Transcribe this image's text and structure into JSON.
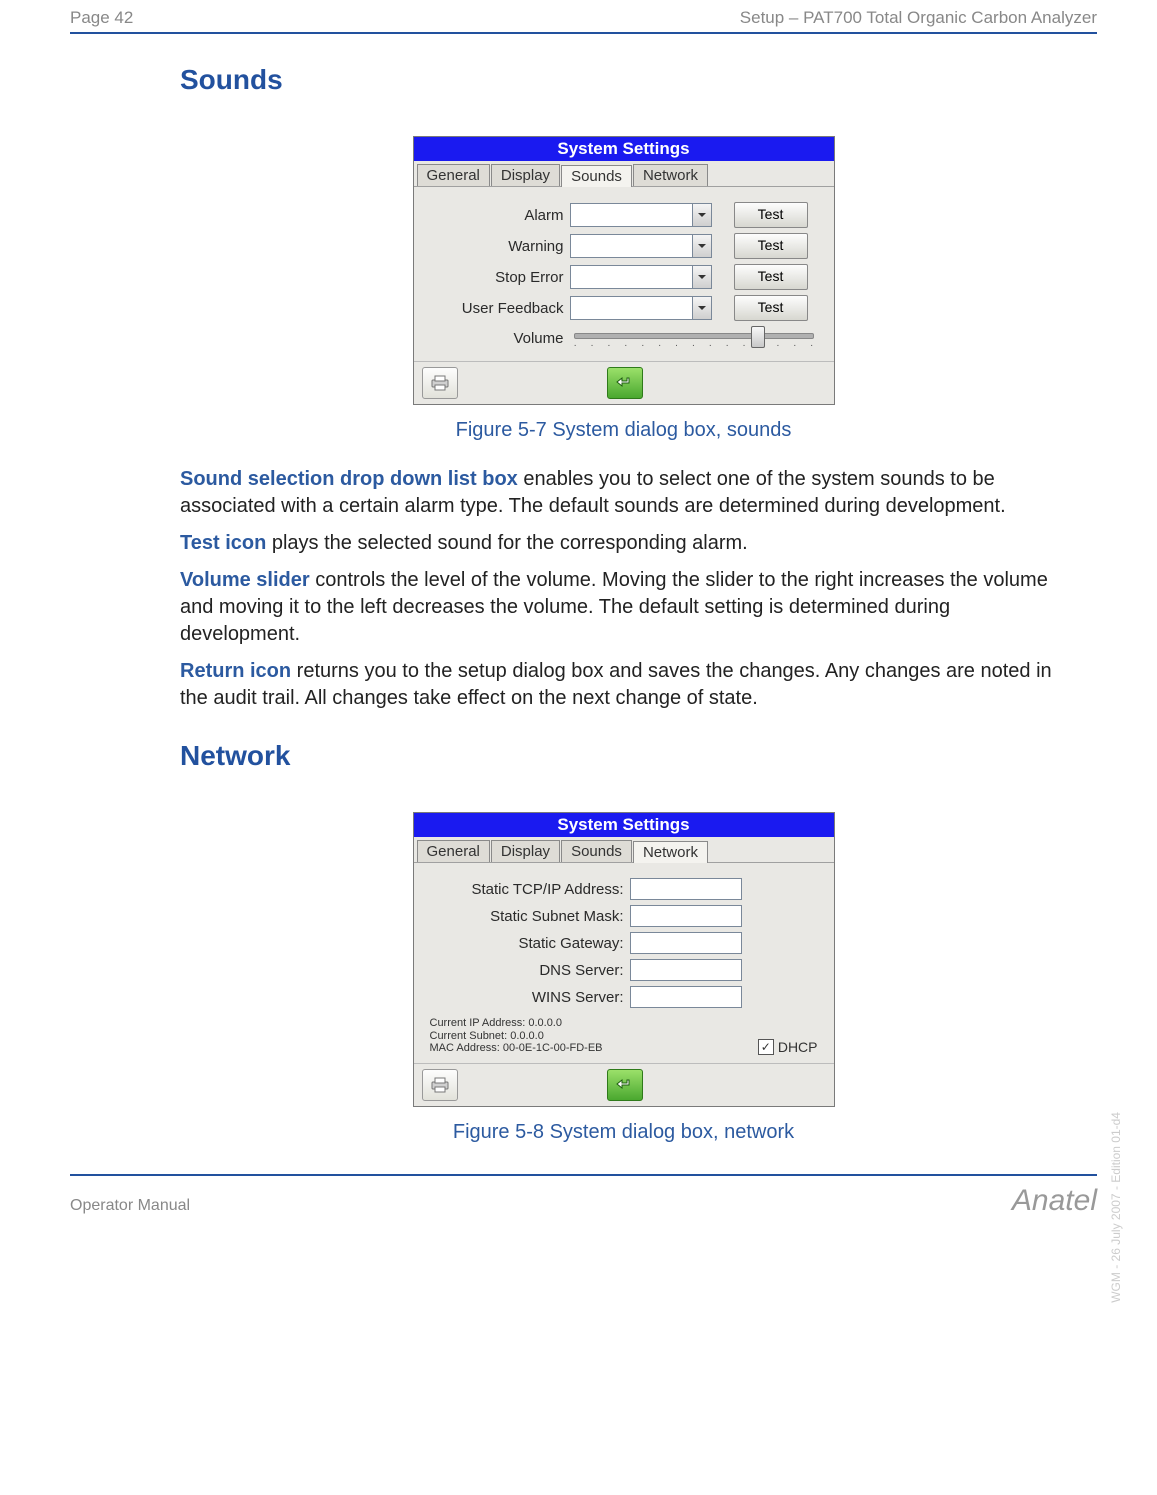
{
  "header": {
    "page_num": "Page 42",
    "section": "Setup – PAT700 Total Organic Carbon Analyzer"
  },
  "footer": {
    "manual": "Operator Manual",
    "brand": "Anatel"
  },
  "side_meta": "WGM - 26 July 2007 - Edition 01-d4",
  "sounds": {
    "heading": "Sounds",
    "dialog_title": "System Settings",
    "tabs": {
      "general": "General",
      "display": "Display",
      "sounds": "Sounds",
      "network": "Network"
    },
    "rows": {
      "alarm": {
        "label": "Alarm",
        "test": "Test"
      },
      "warning": {
        "label": "Warning",
        "test": "Test"
      },
      "stop_error": {
        "label": "Stop Error",
        "test": "Test"
      },
      "user_feedback": {
        "label": "User Feedback",
        "test": "Test"
      },
      "volume": {
        "label": "Volume"
      }
    },
    "caption": "Figure 5-7 System dialog box, sounds",
    "paras": {
      "p1_term": "Sound selection drop down list box",
      "p1_rest": " enables you to select one of the system sounds to be associated with a certain alarm type. The default sounds are determined during development.",
      "p2_term": "Test icon",
      "p2_rest": " plays the selected sound for the corresponding alarm.",
      "p3_term": "Volume slider",
      "p3_rest": " controls the level of the volume. Moving the slider to the right increases the volume and moving it to the left decreases the volume. The default setting is determined during development.",
      "p4_term": "Return icon",
      "p4_rest": " returns you to the setup dialog box and saves the changes. Any changes are noted in the audit trail. All changes take effect on the next change of state."
    }
  },
  "network": {
    "heading": "Network",
    "dialog_title": "System Settings",
    "tabs": {
      "general": "General",
      "display": "Display",
      "sounds": "Sounds",
      "network": "Network"
    },
    "rows": {
      "static_ip": "Static TCP/IP Address:",
      "subnet": "Static Subnet Mask:",
      "gateway": "Static Gateway:",
      "dns": "DNS Server:",
      "wins": "WINS Server:"
    },
    "status": {
      "l1": "Current IP Address: 0.0.0.0",
      "l2": "Current Subnet: 0.0.0.0",
      "l3": "MAC Address: 00-0E-1C-00-FD-EB"
    },
    "dhcp_label": "DHCP",
    "dhcp_checked": "✓",
    "caption": "Figure 5-8 System dialog box, network"
  }
}
